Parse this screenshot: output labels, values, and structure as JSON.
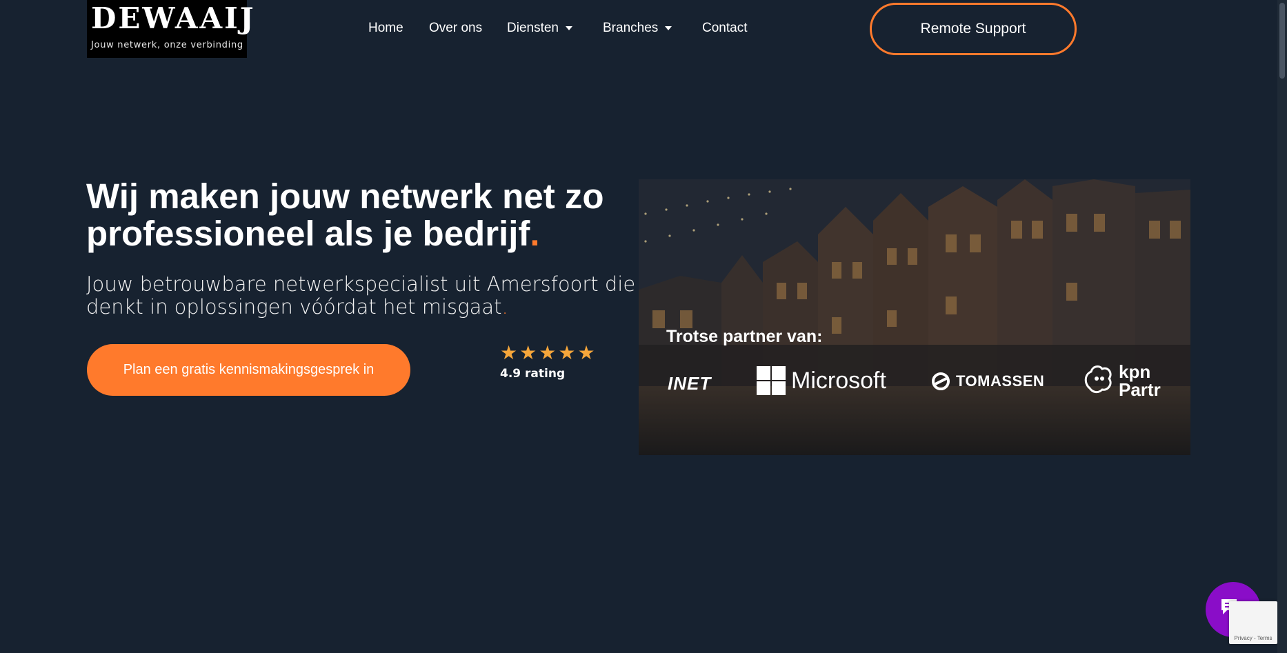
{
  "brand": {
    "name": "DEWAAIJ",
    "tagline": "Jouw netwerk, onze verbinding"
  },
  "nav": {
    "items": [
      {
        "label": "Home"
      },
      {
        "label": "Over ons"
      },
      {
        "label": "Diensten"
      },
      {
        "label": "Branches"
      },
      {
        "label": "Contact"
      }
    ],
    "remote_support": "Remote Support"
  },
  "hero": {
    "title_part1": "Wij maken jouw netwerk net zo professioneel als je bedrijf",
    "title_dot": ".",
    "subtitle": "Jouw betrouwbare netwerkspecialist uit Amersfoort die denkt in oplossingen vóórdat het misgaat",
    "subtitle_dot": ".",
    "cta": "Plan een gratis kennismakingsgesprek in",
    "rating_stars": 5,
    "rating_label": "4.9 rating"
  },
  "partners": {
    "title": "Trotse partner van:",
    "logos": [
      "INET",
      "Microsoft",
      "TOMASSEN",
      "kpn",
      "Partr"
    ]
  },
  "recaptcha": {
    "text": "Privacy - Terms"
  },
  "colors": {
    "background": "#172230",
    "accent": "#ff7a2c",
    "star": "#f5a63b",
    "chat": "#8a0dc8"
  }
}
